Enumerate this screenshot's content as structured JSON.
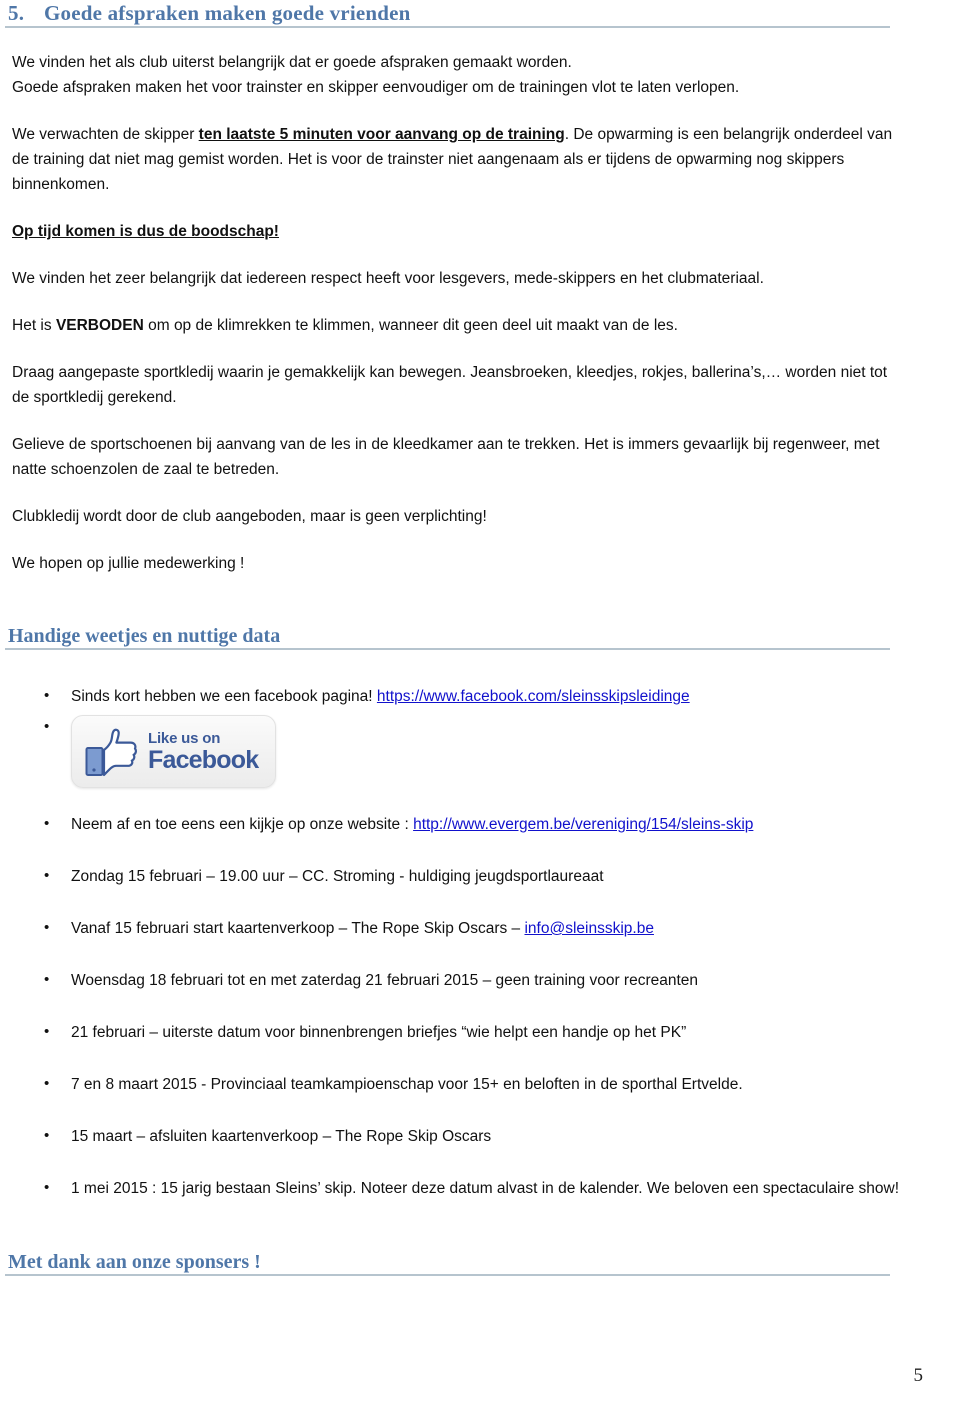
{
  "section": {
    "number": "5.",
    "title": "Goede afspraken maken goede vrienden"
  },
  "paragraphs": {
    "p1_line1": "We vinden het als club uiterst belangrijk dat er goede afspraken gemaakt worden.",
    "p1_line2": "Goede afspraken maken het voor trainster en skipper eenvoudiger om de trainingen vlot te laten verlopen.",
    "p2_pre": "We verwachten de skipper ",
    "p2_emphasis": "ten laatste 5 minuten voor aanvang op de training",
    "p2_post": ". De opwarming is een belangrijk onderdeel van de training dat niet mag gemist worden. Het is voor de trainster niet aangenaam als er tijdens de opwarming nog skippers binnenkomen.",
    "p3_heading": "Op tijd komen is dus de boodschap!",
    "p4": "We vinden het zeer belangrijk dat iedereen respect heeft voor lesgevers, mede-skippers en het clubmateriaal.",
    "p5_pre": "Het is ",
    "p5_bold": "VERBODEN",
    "p5_post": " om op de klimrekken te klimmen, wanneer dit geen deel uit maakt van de les.",
    "p6": "Draag aangepaste sportkledij waarin je gemakkelijk kan bewegen. Jeansbroeken, kleedjes, rokjes, ballerina’s,… worden niet tot de sportkledij gerekend.",
    "p7": "Gelieve de sportschoenen bij aanvang van de les in de kleedkamer aan te trekken. Het is immers gevaarlijk bij regenweer, met natte schoenzolen de zaal te betreden.",
    "p8": "Clubkledij wordt door de club aangeboden, maar is geen verplichting!",
    "p9": "We hopen op jullie medewerking !"
  },
  "section2": {
    "title": "Handige weetjes en nuttige data"
  },
  "bullets": [
    {
      "pre": "Sinds kort hebben we een facebook pagina! ",
      "link": "https://www.facebook.com/sleinsskipsleidinge",
      "post": ""
    },
    {
      "pre": "Neem af en toe eens een kijkje op onze website : ",
      "link": "http://www.evergem.be/vereniging/154/sleins-skip",
      "post": ""
    },
    {
      "pre": "Zondag 15 februari – 19.00 uur – CC. Stroming - huldiging jeugdsportlaureaat",
      "link": "",
      "post": ""
    },
    {
      "pre": "Vanaf 15 februari start kaartenverkoop – The Rope Skip Oscars – ",
      "link": "info@sleinsskip.be",
      "post": ""
    },
    {
      "pre": "Woensdag 18 februari tot en met zaterdag 21 februari 2015 – geen training voor recreanten",
      "link": "",
      "post": ""
    },
    {
      "pre": "21 februari – uiterste datum voor binnenbrengen briefjes “wie helpt een handje op het PK”",
      "link": "",
      "post": ""
    },
    {
      "pre": "7 en 8 maart 2015 - Provinciaal teamkampioenschap voor 15+ en beloften in de sporthal Ertvelde.",
      "link": "",
      "post": ""
    },
    {
      "pre": "15 maart – afsluiten kaartenverkoop  – The Rope Skip Oscars",
      "link": "",
      "post": ""
    },
    {
      "pre": "1 mei 2015 : 15 jarig bestaan Sleins’ skip. Noteer deze datum alvast in de kalender. We beloven een spectaculaire show!",
      "link": "",
      "post": ""
    }
  ],
  "facebook_badge": {
    "like_text": "Like us on",
    "brand_text": "Facebook"
  },
  "footer": {
    "sponsors_title": "Met dank aan onze sponsers !",
    "page_number": "5"
  },
  "colors": {
    "heading_blue": "#4F77A8",
    "rule_gray": "#B6C4CE",
    "link_blue": "#1111CC",
    "facebook_blue": "#3B5998"
  }
}
